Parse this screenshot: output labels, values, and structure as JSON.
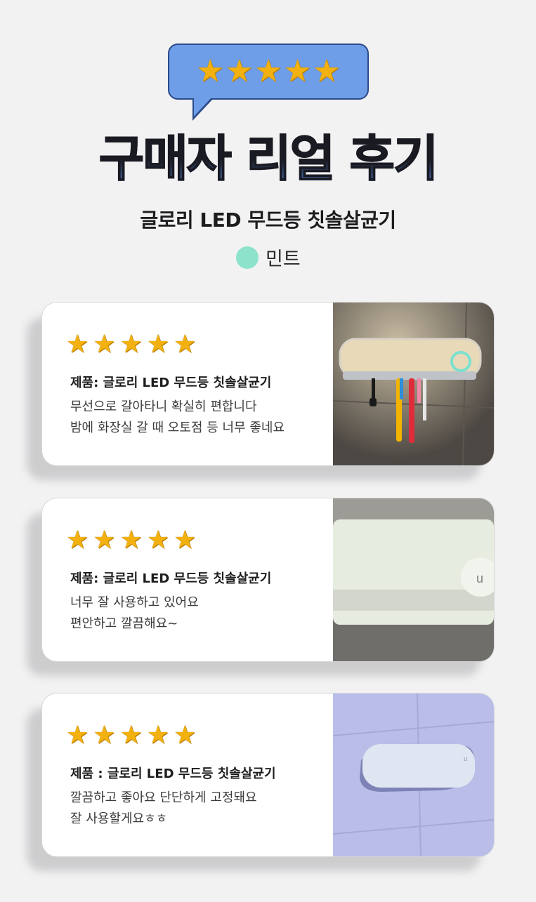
{
  "header": {
    "rating_stars": 5,
    "title": "구매자 리얼 후기",
    "subtitle": "글로리 LED 무드등 칫솔살균기",
    "color_option": {
      "label": "민트",
      "swatch": "#8de2cb"
    }
  },
  "colors": {
    "bubble": "#6f9ee8",
    "star": "#f3b10f",
    "title_gradient_end": "#4e7fd0"
  },
  "reviews": [
    {
      "stars": 5,
      "product": "제품: 글로리 LED 무드등 칫솔살균기",
      "line1": "무선으로 갈아타니 확실히 편합니다",
      "line2": "밤에 화장실 갈 때 오토점 등 너무 좋네요",
      "photo": "toothbrush-sterilizer-lit-photo"
    },
    {
      "stars": 5,
      "product": "제품: 글로리 LED 무드등 칫솔살균기",
      "line1": "너무 잘 사용하고 있어요",
      "line2": "편안하고 깔끔해요~",
      "photo": "sterilizer-closeup-photo"
    },
    {
      "stars": 5,
      "product": "제품 : 글로리 LED 무드등 칫솔살균기",
      "line1": "깔끔하고 좋아요 단단하게 고정돼요",
      "line2": "잘 사용할게요ㅎㅎ",
      "photo": "sterilizer-wall-blue-light-photo"
    }
  ]
}
